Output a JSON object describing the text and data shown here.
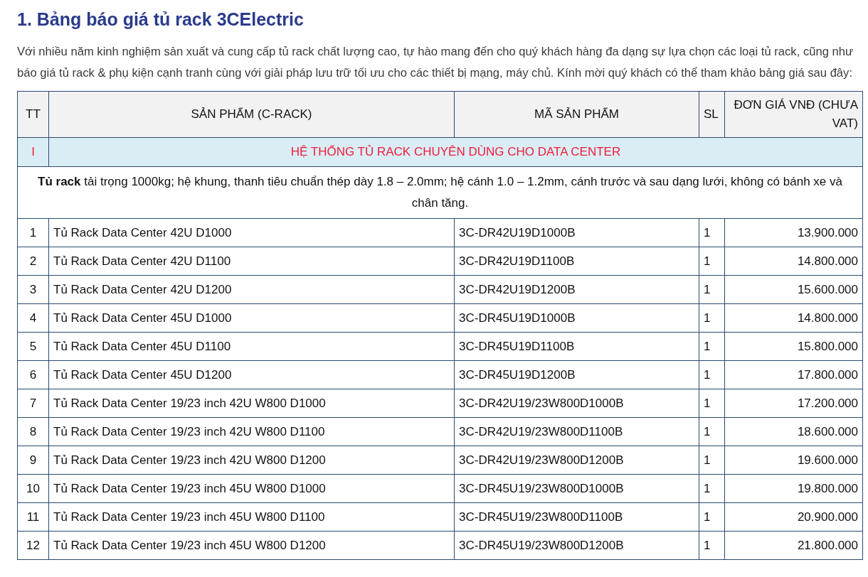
{
  "title": "1. Bảng báo giá tủ rack 3CElectric",
  "intro": "Với nhiều năm kinh nghiệm sản xuất và cung cấp tủ rack chất lượng cao, tự hào mang đến cho quý khách hàng đa dạng sự lựa chọn các loại tủ rack, cũng như báo giá tủ rack & phụ kiện cạnh tranh cùng với giải pháp lưu trữ tối ưu cho các thiết bị mạng, máy chủ. Kính mời quý khách có thể tham khảo bảng giá sau đây:",
  "table": {
    "columns": [
      "TT",
      "SẢN PHẨM (C-RACK)",
      "MÃ SẢN PHẨM",
      "SL",
      "ĐƠN GIÁ VNĐ (CHƯA VAT)"
    ],
    "section": {
      "number": "I",
      "title": "HỆ THỐNG TỦ RACK CHUYÊN DÙNG CHO DATA CENTER"
    },
    "note": "**Tủ rack** tải trọng 1000kg; hệ khung, thanh tiêu chuẩn thép dày 1.8 – 2.0mm; hệ cánh 1.0 – 1.2mm, cánh trước và sau dạng lưới, không có bánh xe và chân tăng.",
    "rows": [
      {
        "no": "1",
        "name": "Tủ Rack Data Center 42U D1000",
        "code": "3C-DR42U19D1000B",
        "qty": "1",
        "price": "13.900.000"
      },
      {
        "no": "2",
        "name": "Tủ Rack Data Center 42U D1100",
        "code": "3C-DR42U19D1100B",
        "qty": "1",
        "price": "14.800.000"
      },
      {
        "no": "3",
        "name": "Tủ Rack Data Center 42U D1200",
        "code": "3C-DR42U19D1200B",
        "qty": "1",
        "price": "15.600.000"
      },
      {
        "no": "4",
        "name": "Tủ Rack Data Center 45U D1000",
        "code": "3C-DR45U19D1000B",
        "qty": "1",
        "price": "14.800.000"
      },
      {
        "no": "5",
        "name": "Tủ Rack Data Center 45U D1100",
        "code": "3C-DR45U19D1100B",
        "qty": "1",
        "price": "15.800.000"
      },
      {
        "no": "6",
        "name": "Tủ Rack Data Center 45U D1200",
        "code": "3C-DR45U19D1200B",
        "qty": "1",
        "price": "17.800.000"
      },
      {
        "no": "7",
        "name": "Tủ Rack Data Center 19/23 inch 42U W800 D1000",
        "code": "3C-DR42U19/23W800D1000B",
        "qty": "1",
        "price": "17.200.000"
      },
      {
        "no": "8",
        "name": "Tủ Rack Data Center 19/23 inch 42U W800 D1100",
        "code": "3C-DR42U19/23W800D1100B",
        "qty": "1",
        "price": "18.600.000"
      },
      {
        "no": "9",
        "name": "Tủ Rack Data Center 19/23 inch 42U W800 D1200",
        "code": "3C-DR42U19/23W800D1200B",
        "qty": "1",
        "price": "19.600.000"
      },
      {
        "no": "10",
        "name": "Tủ Rack Data Center 19/23 inch 45U W800 D1000",
        "code": "3C-DR45U19/23W800D1000B",
        "qty": "1",
        "price": "19.800.000"
      },
      {
        "no": "11",
        "name": "Tủ Rack Data Center 19/23 inch 45U W800 D1100",
        "code": "3C-DR45U19/23W800D1100B",
        "qty": "1",
        "price": "20.900.000"
      },
      {
        "no": "12",
        "name": "Tủ Rack Data Center 19/23 inch 45U W800 D1200",
        "code": "3C-DR45U19/23W800D1200B",
        "qty": "1",
        "price": "21.800.000"
      }
    ]
  }
}
